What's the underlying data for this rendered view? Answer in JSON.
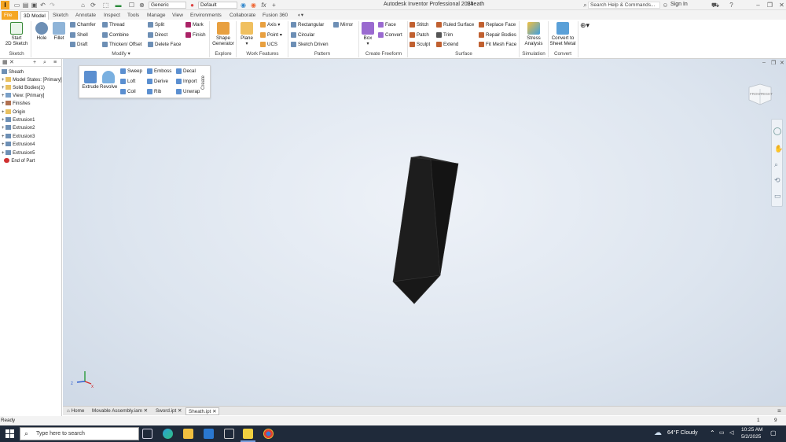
{
  "app": {
    "title": "Autodesk Inventor Professional 2024",
    "doc_title": "Sheath",
    "appearance_combo": "Generic",
    "material_combo": "Default",
    "search_placeholder": "Search Help & Commands...",
    "sign_in": "Sign In"
  },
  "tabs": [
    "File",
    "3D Model",
    "Sketch",
    "Annotate",
    "Inspect",
    "Tools",
    "Manage",
    "View",
    "Environments",
    "Collaborate",
    "Fusion 360"
  ],
  "ribbon": {
    "sketch": {
      "start": "Start",
      "start2": "2D Sketch",
      "group": "Sketch"
    },
    "modify": {
      "hole": "Hole",
      "fillet": "Fillet",
      "chamfer": "Chamfer",
      "shell": "Shell",
      "draft": "Draft",
      "thread": "Thread",
      "combine": "Combine",
      "thicken": "Thicken/ Offset",
      "split": "Split",
      "direct": "Direct",
      "delete_face": "Delete Face",
      "mark": "Mark",
      "finish": "Finish",
      "group": "Modify"
    },
    "explore": {
      "shape": "Shape",
      "shape2": "Generator",
      "group": "Explore"
    },
    "work": {
      "plane": "Plane",
      "axis": "Axis",
      "point": "Point",
      "ucs": "UCS",
      "group": "Work Features"
    },
    "pattern": {
      "rectangular": "Rectangular",
      "circular": "Circular",
      "sketch_driven": "Sketch Driven",
      "mirror": "Mirror",
      "group": "Pattern"
    },
    "freeform": {
      "box": "Box",
      "face": "Face",
      "convert": "Convert",
      "group": "Create Freeform"
    },
    "surface": {
      "stitch": "Stitch",
      "patch": "Patch",
      "sculpt": "Sculpt",
      "ruled": "Ruled Surface",
      "trim": "Trim",
      "extend": "Extend",
      "replace": "Replace Face",
      "repair": "Repair Bodies",
      "fitmesh": "Fit Mesh Face",
      "group": "Surface"
    },
    "simulation": {
      "stress": "Stress",
      "stress2": "Analysis",
      "group": "Simulation"
    },
    "convert": {
      "sheet": "Convert to",
      "sheet2": "Sheet Metal",
      "group": "Convert"
    }
  },
  "create_panel": {
    "extrude": "Extrude",
    "revolve": "Revolve",
    "sweep": "Sweep",
    "loft": "Loft",
    "coil": "Coil",
    "emboss": "Emboss",
    "derive": "Derive",
    "rib": "Rib",
    "decal": "Decal",
    "import": "Import",
    "unwrap": "Unwrap",
    "title": "Create"
  },
  "browser": {
    "root": "Sheath",
    "items": [
      "Model States: [Primary]",
      "Solid Bodies(1)",
      "View: [Primary]",
      "Finishes",
      "Origin",
      "Extrusion1",
      "Extrusion2",
      "Extrusion3",
      "Extrusion4",
      "Extrusion5",
      "End of Part"
    ]
  },
  "viewcube": {
    "front": "FRONT",
    "right": "RIGHT"
  },
  "doc_tabs": [
    "Home",
    "Movable Assembly.iam",
    "Sword.ipt",
    "Sheath.ipt"
  ],
  "status": {
    "text": "Ready",
    "n1": "1",
    "n2": "9"
  },
  "taskbar": {
    "search": "Type here to search",
    "weather": "64°F  Cloudy",
    "time": "10:25 AM",
    "date": "5/2/2025"
  },
  "colors": {
    "accent": "#f5a623",
    "taskbar": "#1f2a3a",
    "part": "#1b1b1b"
  }
}
